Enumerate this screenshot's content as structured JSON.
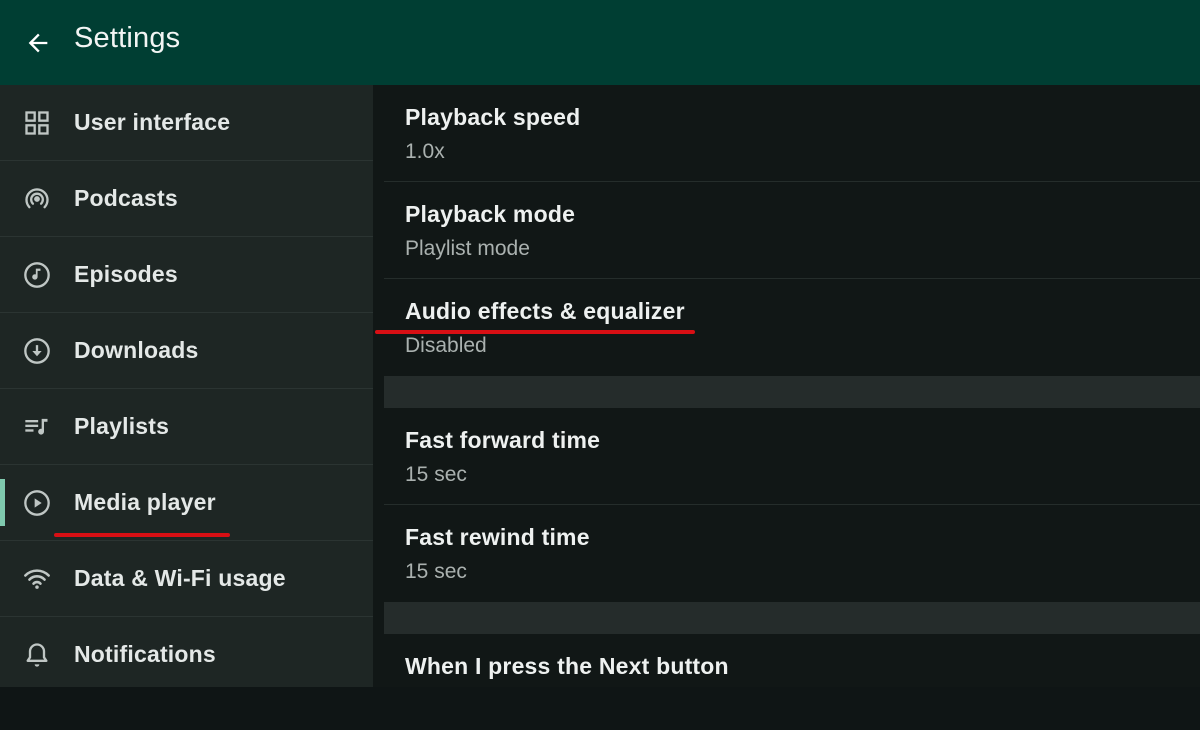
{
  "app": {
    "title": "Settings"
  },
  "sidebar": {
    "items": [
      {
        "label": "User interface",
        "icon": "grid-icon"
      },
      {
        "label": "Podcasts",
        "icon": "podcast-icon"
      },
      {
        "label": "Episodes",
        "icon": "music-note-icon"
      },
      {
        "label": "Downloads",
        "icon": "download-icon"
      },
      {
        "label": "Playlists",
        "icon": "playlist-icon"
      },
      {
        "label": "Media player",
        "icon": "play-circle-icon",
        "selected": true
      },
      {
        "label": "Data & Wi-Fi usage",
        "icon": "wifi-icon"
      },
      {
        "label": "Notifications",
        "icon": "bell-icon"
      }
    ]
  },
  "main": {
    "prefs": [
      {
        "title": "Playback speed",
        "summary": "1.0x"
      },
      {
        "title": "Playback mode",
        "summary": "Playlist mode"
      },
      {
        "title": "Audio effects & equalizer",
        "summary": "Disabled"
      },
      {
        "title": "Fast forward time",
        "summary": "15 sec"
      },
      {
        "title": "Fast rewind time",
        "summary": "15 sec"
      },
      {
        "title": "When I press the Next button",
        "summary": ""
      }
    ]
  },
  "colors": {
    "appbar": "#003e33",
    "sidebar": "#1e2624",
    "content": "#111716",
    "accent": "#7fc9ae",
    "annotation": "#d80f14"
  }
}
